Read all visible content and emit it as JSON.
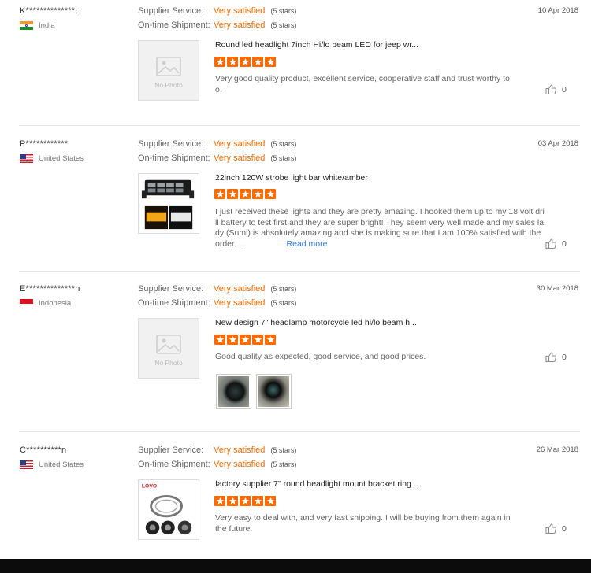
{
  "labels": {
    "supplier_service": "Supplier Service:",
    "ontime_shipment": "On-time Shipment:",
    "no_photo": "No Photo",
    "read_more": "Read more"
  },
  "colors": {
    "accent": "#f36b00",
    "star": "#ff6a00",
    "link": "#2a7ae2"
  },
  "reviews": [
    {
      "buyer": "K**************t",
      "country": "India",
      "flag": "india-flag-icon",
      "date": "10 Apr 2018",
      "supplier_rating": "Very satisfied",
      "supplier_stars": "(5 stars)",
      "shipment_rating": "Very satisfied",
      "shipment_stars": "(5 stars)",
      "product_title": "Round led headlight 7inch Hi/lo beam LED for jeep wr...",
      "rating": 5,
      "comment": "Very good quality product, excellent service, cooperative staff  and trust worthy too.",
      "likes": "0"
    },
    {
      "buyer": "P************",
      "country": "United States",
      "flag": "us-flag-icon",
      "date": "03 Apr 2018",
      "supplier_rating": "Very satisfied",
      "supplier_stars": "(5 stars)",
      "shipment_rating": "Very satisfied",
      "shipment_stars": "(5 stars)",
      "product_title": "22inch 120W strobe light bar white/amber",
      "rating": 5,
      "comment": "I just received these lights and they are pretty amazing. I hooked them up to my 18 volt drill battery to test first and they are super bright! They seem very well made and my sales lady (Sumi) is absolutely amazing and she is making sure that I am 100% satisfied with the order. ...",
      "likes": "0"
    },
    {
      "buyer": "E**************h",
      "country": "Indonesia",
      "flag": "indonesia-flag-icon",
      "date": "30 Mar 2018",
      "supplier_rating": "Very satisfied",
      "supplier_stars": "(5 stars)",
      "shipment_rating": "Very satisfied",
      "shipment_stars": "(5 stars)",
      "product_title": "New design 7\" headlamp motorcycle led hi/lo beam h...",
      "rating": 5,
      "comment": "Good quality as expected, good service, and good prices.",
      "likes": "0"
    },
    {
      "buyer": "C**********n",
      "country": "United States",
      "flag": "us-flag-icon",
      "date": "26 Mar 2018",
      "supplier_rating": "Very satisfied",
      "supplier_stars": "(5 stars)",
      "shipment_rating": "Very satisfied",
      "shipment_stars": "(5 stars)",
      "product_title": "factory supplier 7\" round headlight mount bracket ring...",
      "rating": 5,
      "comment": "Very easy to deal with, and very fast shipping.  I will be buying from them again in the future.",
      "likes": "0"
    }
  ]
}
